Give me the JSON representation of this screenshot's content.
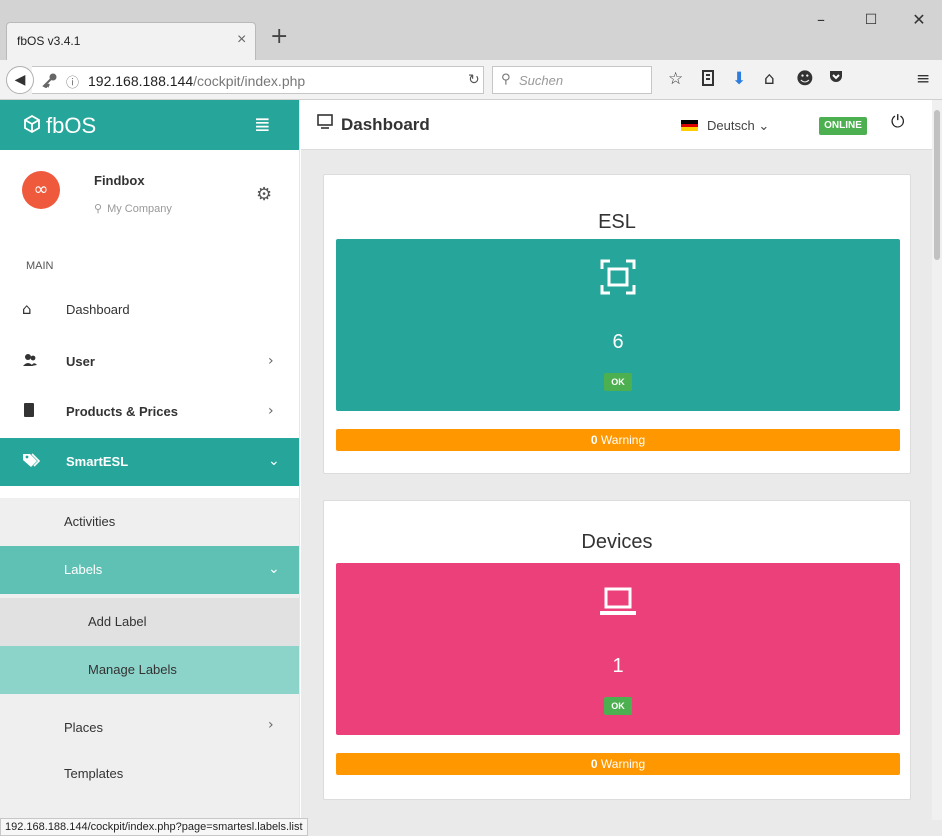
{
  "browser": {
    "tab_title": "fbOS v3.4.1",
    "tab_close": "×",
    "new_tab": "+",
    "window": {
      "minimize": "–",
      "maximize": "☐",
      "close": "✕"
    },
    "url_host": "192.168.188.144",
    "url_path": "/cockpit/index.php",
    "search_placeholder": "Suchen",
    "status_url": "192.168.188.144/cockpit/index.php?page=smartesl.labels.list"
  },
  "sidebar": {
    "brand": "fbOS",
    "profile": {
      "name": "Findbox",
      "company": "My Company",
      "avatar_glyph": "∞"
    },
    "section": "MAIN",
    "items": [
      {
        "label": "Dashboard",
        "icon": "home-icon"
      },
      {
        "label": "User",
        "icon": "users-icon"
      },
      {
        "label": "Products & Prices",
        "icon": "book-icon"
      },
      {
        "label": "SmartESL",
        "icon": "tags-icon"
      }
    ],
    "smartesl_sub": [
      {
        "label": "Activities"
      },
      {
        "label": "Labels"
      },
      {
        "label": "Places"
      },
      {
        "label": "Templates"
      }
    ],
    "labels_sub": [
      {
        "label": "Add Label"
      },
      {
        "label": "Manage Labels"
      }
    ]
  },
  "header": {
    "title": "Dashboard",
    "language": "Deutsch",
    "status": "ONLINE"
  },
  "cards": [
    {
      "title": "ESL",
      "count": "6",
      "ok": "OK",
      "warning_count": "0",
      "warning_label": "Warning",
      "color": "#26a69a"
    },
    {
      "title": "Devices",
      "count": "1",
      "ok": "OK",
      "warning_count": "0",
      "warning_label": "Warning",
      "color": "#ec407a"
    }
  ],
  "colors": {
    "accent": "#26a69a",
    "pink": "#ec407a",
    "warning": "#ff9800",
    "ok": "#4caf50"
  }
}
